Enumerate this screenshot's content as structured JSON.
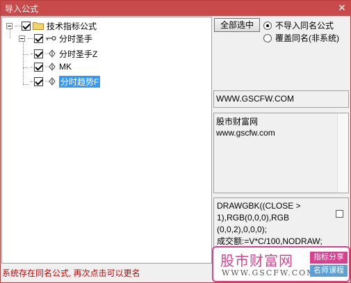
{
  "window": {
    "title": "导入公式",
    "close_glyph": "✕"
  },
  "tree": {
    "root": {
      "label": "技术指标公式",
      "checked": true,
      "icon": "folder-icon"
    },
    "group": {
      "label": "分时圣手",
      "checked": true,
      "icon": "key-icon"
    },
    "items": [
      {
        "label": "分时圣手Z",
        "checked": true,
        "icon": "formula-icon",
        "selected": false
      },
      {
        "label": "MK",
        "checked": true,
        "icon": "formula-icon",
        "selected": false
      },
      {
        "label": "分时趋势F",
        "checked": true,
        "icon": "formula-icon",
        "selected": true
      }
    ]
  },
  "status": {
    "message": "系统存在同名公式, 再次点击可以更名",
    "color": "#cc0000"
  },
  "options": {
    "select_all_label": "全部选中",
    "radio_no_import": "不导入同名公式",
    "radio_overwrite": "覆盖同名(非系统)",
    "selected_radio": "radio_no_import"
  },
  "url_box": {
    "text": "WWW.GSCFW.COM"
  },
  "info_box": {
    "line1": "股市财富网",
    "line2": "www.gscfw.com"
  },
  "code_box": {
    "lines": [
      "DRAWGBK((CLOSE >",
      "1),RGB(0,0,0),RGB",
      "(0,0,2),0,0,0);",
      "成交额:=V*C/100,NODRAW;"
    ]
  },
  "banner": {
    "main_text": "股市财富网",
    "url_text": "WWW.GSCFW.COM",
    "tag1": "指标分享",
    "tag2": "名师课程",
    "accent_color": "#d6418c",
    "tag2_color": "#5a9fd6"
  },
  "colors": {
    "titlebar": "#c94a4a",
    "selection": "#3399ff"
  }
}
